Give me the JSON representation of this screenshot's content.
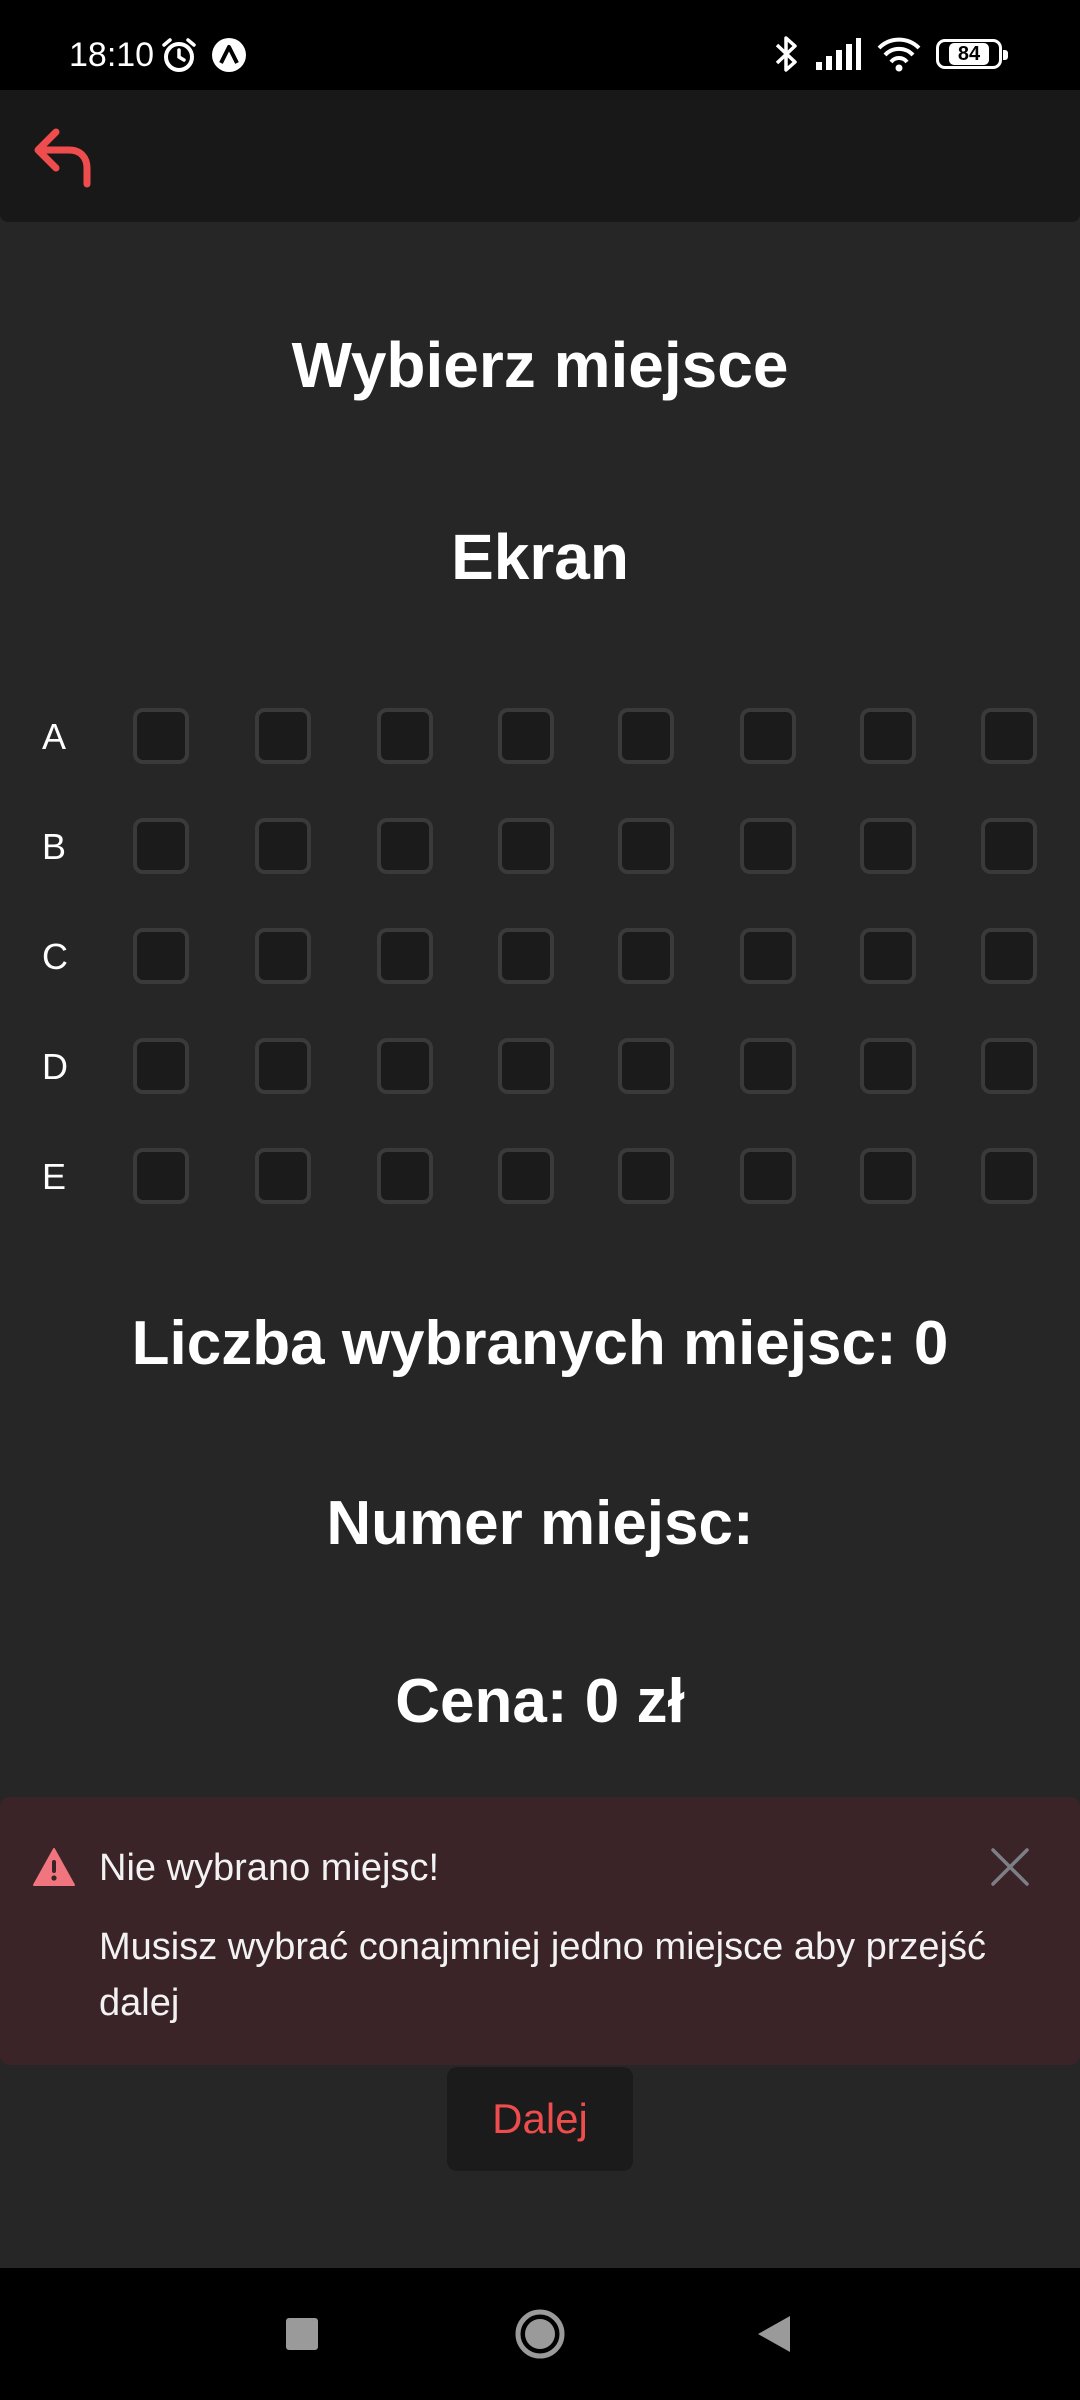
{
  "status_bar": {
    "time": "18:10",
    "left_icons": [
      "alarm-icon",
      "app-notification-icon"
    ],
    "right_icons": [
      "bluetooth-icon",
      "signal-icon",
      "wifi-icon",
      "battery-icon"
    ],
    "battery_level": "84"
  },
  "header": {
    "back_icon": "back-arrow-icon",
    "accent_color": "#ef4d4d"
  },
  "page": {
    "title": "Wybierz miejsce",
    "screen_label": "Ekran"
  },
  "seat_map": {
    "rows": [
      {
        "label": "A",
        "seats": 8
      },
      {
        "label": "B",
        "seats": 8
      },
      {
        "label": "C",
        "seats": 8
      },
      {
        "label": "D",
        "seats": 8
      },
      {
        "label": "E",
        "seats": 8
      }
    ],
    "selected": []
  },
  "summary": {
    "count_text": "Liczba wybranych miejsc: 0",
    "numbers_text": "Numer miejsc:",
    "price_text": "Cena: 0 zł"
  },
  "alert": {
    "icon": "warning-icon",
    "title": "Nie wybrano miejsc!",
    "message": "Musisz wybrać conajmniej jedno miejsce aby przejść dalej",
    "close_icon": "close-icon",
    "background": "#3a2428",
    "icon_color": "#f0757f"
  },
  "actions": {
    "next_label": "Dalej"
  },
  "nav_bar": {
    "buttons": [
      "recents-icon",
      "home-icon",
      "back-icon"
    ]
  }
}
